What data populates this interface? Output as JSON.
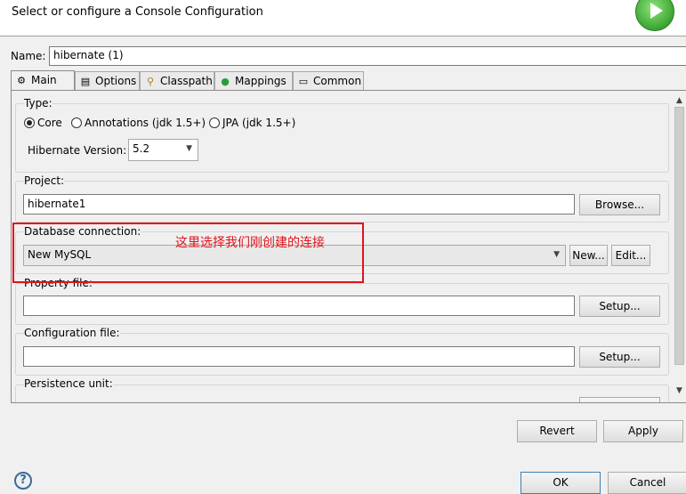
{
  "header": {
    "title": "Select or configure a Console Configuration",
    "icon": "run-icon"
  },
  "name": {
    "label": "Name:",
    "value": "hibernate (1)"
  },
  "tabs": [
    {
      "label": "Main",
      "icon": "hibernate-icon"
    },
    {
      "label": "Options",
      "icon": "table-icon"
    },
    {
      "label": "Classpath",
      "icon": "classpath-icon"
    },
    {
      "label": "Mappings",
      "icon": "mappings-icon"
    },
    {
      "label": "Common",
      "icon": "common-icon"
    }
  ],
  "main": {
    "type": {
      "label": "Type:",
      "options": [
        "Core",
        "Annotations (jdk 1.5+)",
        "JPA (jdk 1.5+)"
      ],
      "selected": "Core"
    },
    "hibernate_version": {
      "label": "Hibernate Version:",
      "value": "5.2"
    },
    "project": {
      "label": "Project:",
      "value": "hibernate1",
      "browse": "Browse..."
    },
    "database_connection": {
      "label": "Database connection:",
      "value": "New MySQL",
      "new": "New...",
      "edit": "Edit..."
    },
    "property_file": {
      "label": "Property file:",
      "value": "",
      "setup": "Setup..."
    },
    "configuration_file": {
      "label": "Configuration file:",
      "value": "",
      "setup": "Setup..."
    },
    "persistence_unit": {
      "label": "Persistence unit:"
    }
  },
  "annotation": {
    "text": "这里选择我们刚创建的连接",
    "color": "#e0141a"
  },
  "footer": {
    "revert": "Revert",
    "apply": "Apply",
    "ok": "OK",
    "cancel": "Cancel"
  }
}
